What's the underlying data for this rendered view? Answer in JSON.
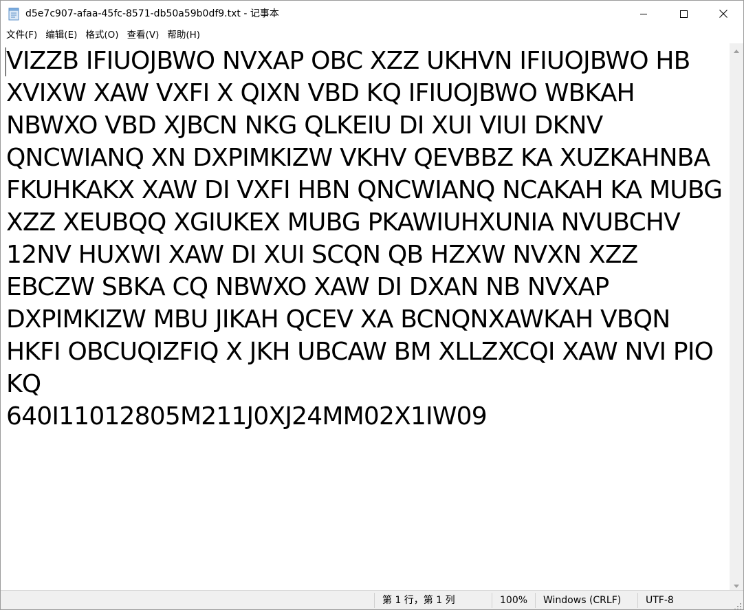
{
  "window": {
    "title": "d5e7c907-afaa-45fc-8571-db50a59b0df9.txt - 记事本",
    "icon": "notepad-icon"
  },
  "menu": {
    "items": [
      "文件(F)",
      "编辑(E)",
      "格式(O)",
      "查看(V)",
      "帮助(H)"
    ]
  },
  "editor": {
    "content": "VIZZB IFIUOJBWO NVXAP OBC XZZ UKHVN IFIUOJBWO HB XVIXW XAW VXFI X QIXN VBD KQ IFIUOJBWO WBKAH NBWXO VBD XJBCN NKG QLKEIU DI XUI VIUI DKNV QNCWIANQ XN DXPIMKIZW VKHV QEVBBZ KA XUZKAHNBA FKUHKAKX XAW DI VXFI HBN QNCWIANQ NCAKAH KA MUBG XZZ XEUBQQ XGIUKEX MUBG PKAWIUHXUNIA NVUBCHV 12NV HUXWI XAW DI XUI SCQN QB HZXW NVXN XZZ EBCZW SBKA CQ NBWXO XAW DI DXAN NB NVXAP DXPIMKIZW MBU JIKAH QCEV XA BCNQNXAWKAH VBQN HKFI OBCUQIZFIQ X JKH UBCAW BM XLLZXCQI XAW NVI PIO KQ\n640I11012805M211J0XJ24MM02X1IW09"
  },
  "status": {
    "position": "第 1 行，第 1 列",
    "zoom": "100%",
    "line_ending": "Windows (CRLF)",
    "encoding": "UTF-8"
  }
}
